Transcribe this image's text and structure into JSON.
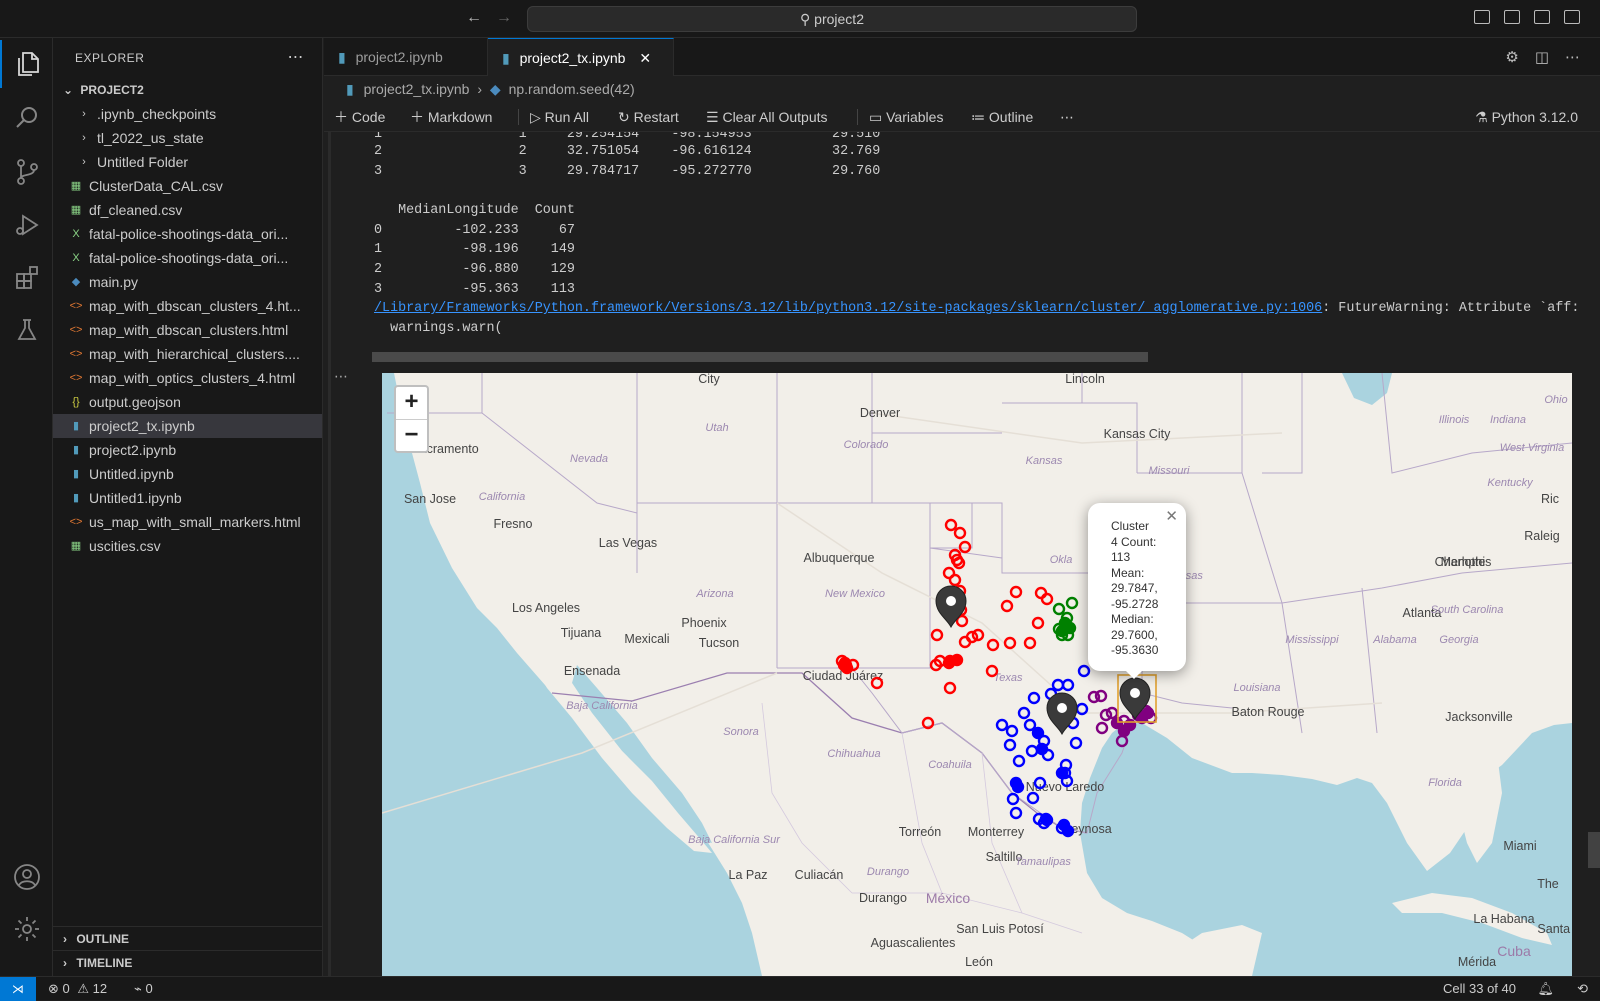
{
  "titlebar": {
    "search": "project2"
  },
  "sidebar": {
    "title": "EXPLORER",
    "project": "PROJECT2",
    "items": [
      {
        "label": ".ipynb_checkpoints",
        "type": "folder"
      },
      {
        "label": "tl_2022_us_state",
        "type": "folder"
      },
      {
        "label": "Untitled Folder",
        "type": "folder"
      },
      {
        "label": "ClusterData_CAL.csv",
        "type": "csv"
      },
      {
        "label": "df_cleaned.csv",
        "type": "csv"
      },
      {
        "label": "fatal-police-shootings-data_ori...",
        "type": "excel"
      },
      {
        "label": "fatal-police-shootings-data_ori...",
        "type": "excel"
      },
      {
        "label": "main.py",
        "type": "python"
      },
      {
        "label": "map_with_dbscan_clusters_4.ht...",
        "type": "html"
      },
      {
        "label": "map_with_dbscan_clusters.html",
        "type": "html"
      },
      {
        "label": "map_with_hierarchical_clusters....",
        "type": "html"
      },
      {
        "label": "map_with_optics_clusters_4.html",
        "type": "html"
      },
      {
        "label": "output.geojson",
        "type": "json"
      },
      {
        "label": "project2_tx.ipynb",
        "type": "notebook"
      },
      {
        "label": "project2.ipynb",
        "type": "notebook"
      },
      {
        "label": "Untitled.ipynb",
        "type": "notebook"
      },
      {
        "label": "Untitled1.ipynb",
        "type": "notebook"
      },
      {
        "label": "us_map_with_small_markers.html",
        "type": "html"
      },
      {
        "label": "uscities.csv",
        "type": "csv"
      }
    ],
    "outline": "OUTLINE",
    "timeline": "TIMELINE"
  },
  "tabs": [
    {
      "label": "project2.ipynb",
      "active": false
    },
    {
      "label": "project2_tx.ipynb",
      "active": true
    }
  ],
  "breadcrumb": {
    "file": "project2_tx.ipynb",
    "symbol": "np.random.seed(42)"
  },
  "toolbar": {
    "code": "Code",
    "markdown": "Markdown",
    "run_all": "Run All",
    "restart": "Restart",
    "clear": "Clear All Outputs",
    "variables": "Variables",
    "outline": "Outline",
    "kernel": "Python 3.12.0"
  },
  "output": {
    "line1": "1                 1     29.254154    -98.154953          29.510",
    "line2": "2                 2     32.751054    -96.616124          32.769",
    "line3": "3                 3     29.784717    -95.272770          29.760",
    "header2": "   MedianLongitude  Count",
    "row0": "0         -102.233     67",
    "row1": "1          -98.196    149",
    "row2": "2          -96.880    129",
    "row3": "3          -95.363    113",
    "warn_path": "/Library/Frameworks/Python.framework/Versions/3.12/lib/python3.12/site-packages/sklearn/cluster/_agglomerative.py:1006",
    "warn_msg": ": FutureWarning: Attribute `aff:",
    "warn_call": "  warnings.warn("
  },
  "map": {
    "zoom_in": "+",
    "zoom_out": "−",
    "places": [
      {
        "name": "City",
        "type": "city"
      },
      {
        "name": "Lincoln",
        "type": "city"
      },
      {
        "name": "Denver",
        "type": "city"
      },
      {
        "name": "Utah",
        "type": "state"
      },
      {
        "name": "Colorado",
        "type": "state"
      },
      {
        "name": "Kansas City",
        "type": "city"
      },
      {
        "name": "Illinois",
        "type": "state"
      },
      {
        "name": "Indiana",
        "type": "state"
      },
      {
        "name": "Ohio",
        "type": "state"
      },
      {
        "name": "Sacramento",
        "type": "city"
      },
      {
        "name": "Nevada",
        "type": "state"
      },
      {
        "name": "Kansas",
        "type": "state"
      },
      {
        "name": "Missouri",
        "type": "state"
      },
      {
        "name": "West Virginia",
        "type": "state"
      },
      {
        "name": "San Jose",
        "type": "city"
      },
      {
        "name": "California",
        "type": "state"
      },
      {
        "name": "Kentucky",
        "type": "state"
      },
      {
        "name": "Ric",
        "type": "city"
      },
      {
        "name": "Fresno",
        "type": "city"
      },
      {
        "name": "Raleig",
        "type": "city"
      },
      {
        "name": "Las Vegas",
        "type": "city"
      },
      {
        "name": "Albuquerque",
        "type": "city"
      },
      {
        "name": "Okla",
        "type": "state"
      },
      {
        "name": "Arkansas",
        "type": "state"
      },
      {
        "name": "Memphis",
        "type": "city"
      },
      {
        "name": "Charlotte",
        "type": "city"
      },
      {
        "name": "Arizona",
        "type": "state"
      },
      {
        "name": "New Mexico",
        "type": "state"
      },
      {
        "name": "Los Angeles",
        "type": "city"
      },
      {
        "name": "Atlanta",
        "type": "city"
      },
      {
        "name": "South Carolina",
        "type": "state"
      },
      {
        "name": "Tijuana",
        "type": "city"
      },
      {
        "name": "Mexicali",
        "type": "city"
      },
      {
        "name": "Phoenix",
        "type": "city"
      },
      {
        "name": "Tucson",
        "type": "city"
      },
      {
        "name": "Mississippi",
        "type": "state"
      },
      {
        "name": "Alabama",
        "type": "state"
      },
      {
        "name": "Georgia",
        "type": "state"
      },
      {
        "name": "Ensenada",
        "type": "city"
      },
      {
        "name": "Ciudad Juárez",
        "type": "city"
      },
      {
        "name": "Texas",
        "type": "state"
      },
      {
        "name": "Louisiana",
        "type": "state"
      },
      {
        "name": "Baja California",
        "type": "state"
      },
      {
        "name": "Baton Rouge",
        "type": "city"
      },
      {
        "name": "Jacksonville",
        "type": "city"
      },
      {
        "name": "Sonora",
        "type": "state"
      },
      {
        "name": "Chihuahua",
        "type": "state"
      },
      {
        "name": "Coahuila",
        "type": "state"
      },
      {
        "name": "Florida",
        "type": "state"
      },
      {
        "name": "Nuevo Laredo",
        "type": "city"
      },
      {
        "name": "Baja California Sur",
        "type": "state"
      },
      {
        "name": "Torreón",
        "type": "city"
      },
      {
        "name": "Monterrey",
        "type": "city"
      },
      {
        "name": "Reynosa",
        "type": "city"
      },
      {
        "name": "Miami",
        "type": "city"
      },
      {
        "name": "Saltillo",
        "type": "city"
      },
      {
        "name": "Tamaulipas",
        "type": "state"
      },
      {
        "name": "La Paz",
        "type": "city"
      },
      {
        "name": "Culiacán",
        "type": "city"
      },
      {
        "name": "Durango",
        "type": "state"
      },
      {
        "name": "The",
        "type": "city"
      },
      {
        "name": "Durango",
        "type": "city"
      },
      {
        "name": "México",
        "type": "country"
      },
      {
        "name": "La Habana",
        "type": "city"
      },
      {
        "name": "San Luis Potosí",
        "type": "city"
      },
      {
        "name": "Santa C",
        "type": "city"
      },
      {
        "name": "Aguascalientes",
        "type": "city"
      },
      {
        "name": "Cuba",
        "type": "country"
      },
      {
        "name": "Mérida",
        "type": "city"
      },
      {
        "name": "León",
        "type": "city"
      }
    ],
    "popup": {
      "lines": [
        "Cluster",
        "4 Count:",
        "113",
        "Mean:",
        "29.7847,",
        "-95.2728",
        "Median:",
        "29.7600,",
        "-95.3630"
      ]
    },
    "colors": {
      "cluster1": "#ff0000",
      "cluster2": "#008000",
      "cluster3": "#0000ff",
      "cluster4": "#800080"
    }
  },
  "statusbar": {
    "errors": "0",
    "warnings": "12",
    "ports": "0",
    "cell": "Cell 33 of 40"
  }
}
